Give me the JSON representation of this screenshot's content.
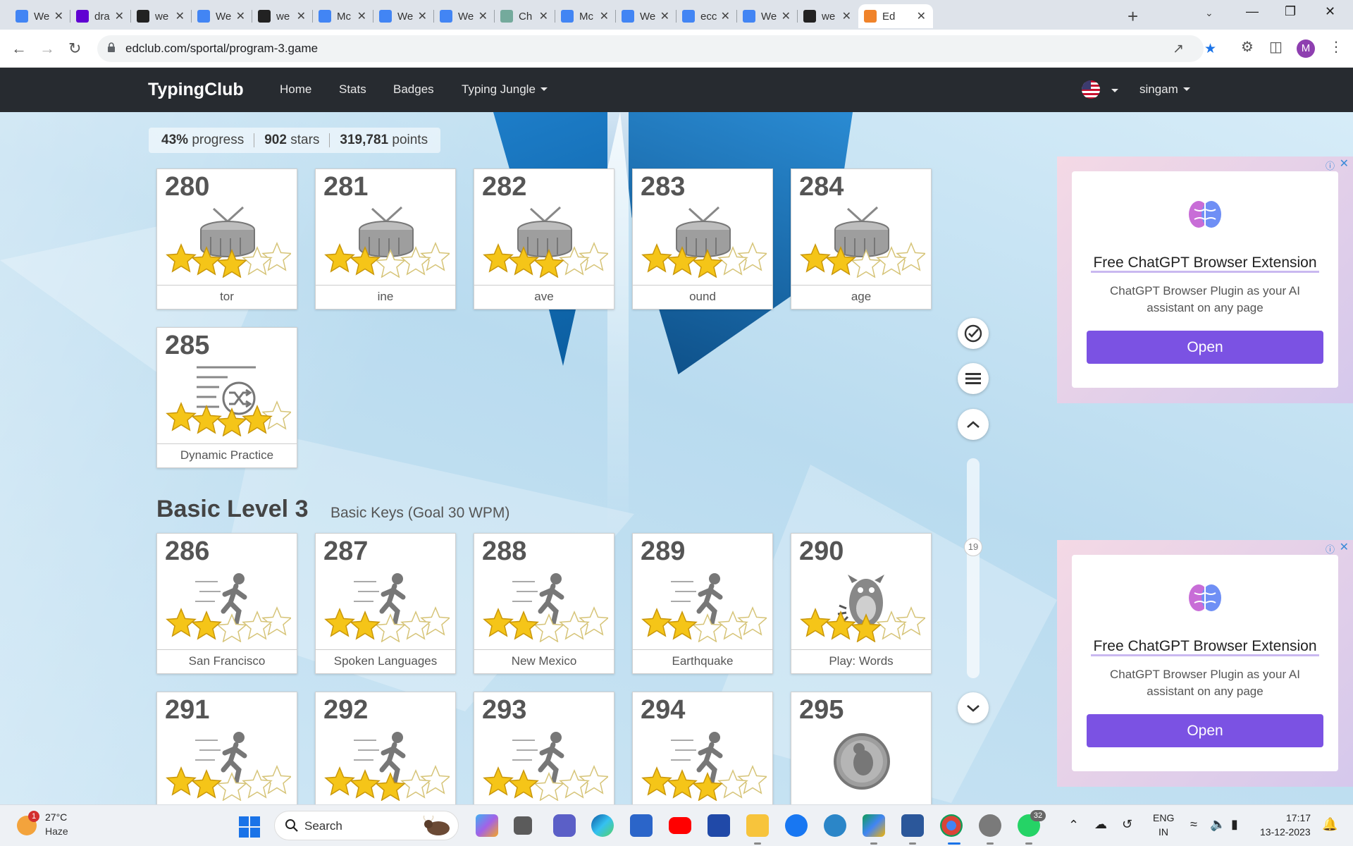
{
  "browser": {
    "tabs": [
      {
        "title": "We",
        "icon": "docs-icon",
        "color": "#4285f4"
      },
      {
        "title": "dra",
        "icon": "yahoo-icon",
        "color": "#6001d2"
      },
      {
        "title": "we",
        "icon": "notion-icon",
        "color": "#222222"
      },
      {
        "title": "We",
        "icon": "docs-icon",
        "color": "#4285f4"
      },
      {
        "title": "we",
        "icon": "notion-icon",
        "color": "#222222"
      },
      {
        "title": "Mc",
        "icon": "docs-icon",
        "color": "#4285f4"
      },
      {
        "title": "We",
        "icon": "docs-icon",
        "color": "#4285f4"
      },
      {
        "title": "We",
        "icon": "docs-icon",
        "color": "#4285f4"
      },
      {
        "title": "Ch",
        "icon": "chatgpt-icon",
        "color": "#74aa9c"
      },
      {
        "title": "Mc",
        "icon": "docs-icon",
        "color": "#4285f4"
      },
      {
        "title": "We",
        "icon": "docs-icon",
        "color": "#4285f4"
      },
      {
        "title": "ecc",
        "icon": "docs-icon",
        "color": "#4285f4"
      },
      {
        "title": "We",
        "icon": "docs-icon",
        "color": "#4285f4"
      },
      {
        "title": "we",
        "icon": "notion-icon",
        "color": "#222222"
      },
      {
        "title": "Ed",
        "icon": "edclub-icon",
        "color": "#f0832a",
        "active": true
      }
    ],
    "url": "edclub.com/sportal/program-3.game",
    "profile_initial": "M"
  },
  "site": {
    "brand": "TypingClub",
    "nav": [
      "Home",
      "Stats",
      "Badges",
      "Typing Jungle"
    ],
    "user": "singam"
  },
  "progress": {
    "percent": "43%",
    "percent_label": "progress",
    "stars": "902",
    "stars_label": "stars",
    "points": "319,781",
    "points_label": "points"
  },
  "lessons_top": [
    {
      "num": "280",
      "label": "tor",
      "stars": 3,
      "art": "drum-icon"
    },
    {
      "num": "281",
      "label": "ine",
      "stars": 2,
      "art": "drum-icon"
    },
    {
      "num": "282",
      "label": "ave",
      "stars": 3,
      "art": "drum-icon"
    },
    {
      "num": "283",
      "label": "ound",
      "stars": 3,
      "art": "drum-icon"
    },
    {
      "num": "284",
      "label": "age",
      "stars": 2,
      "art": "drum-icon"
    },
    {
      "num": "285",
      "label": "Dynamic Practice",
      "stars": 4,
      "art": "shuffle-icon"
    }
  ],
  "level": {
    "title": "Basic Level 3",
    "subtitle": "Basic Keys (Goal 30 WPM)"
  },
  "lessons_level3": [
    {
      "num": "286",
      "label": "San Francisco",
      "stars": 2,
      "art": "runner-icon"
    },
    {
      "num": "287",
      "label": "Spoken Languages",
      "stars": 2,
      "art": "runner-icon"
    },
    {
      "num": "288",
      "label": "New Mexico",
      "stars": 2,
      "art": "runner-icon"
    },
    {
      "num": "289",
      "label": "Earthquake",
      "stars": 2,
      "art": "runner-icon"
    },
    {
      "num": "290",
      "label": "Play: Words",
      "stars": 3,
      "art": "monster-icon"
    },
    {
      "num": "291",
      "label": "",
      "stars": 2,
      "art": "runner-icon"
    },
    {
      "num": "292",
      "label": "",
      "stars": 3,
      "art": "runner-icon"
    },
    {
      "num": "293",
      "label": "",
      "stars": 2,
      "art": "runner-icon"
    },
    {
      "num": "294",
      "label": "",
      "stars": 3,
      "art": "runner-icon"
    },
    {
      "num": "295",
      "label": "",
      "stars": 0,
      "art": "game-badge-icon"
    }
  ],
  "side_controls": {
    "scroll_number": "19"
  },
  "ads": [
    {
      "title": "Free ChatGPT Browser Extension",
      "desc": "ChatGPT Browser Plugin as your AI assistant on any page",
      "button": "Open"
    },
    {
      "title": "Free ChatGPT Browser Extension",
      "desc": "ChatGPT Browser Plugin as your AI assistant on any page",
      "button": "Open"
    }
  ],
  "taskbar": {
    "weather_temp": "27°C",
    "weather_cond": "Haze",
    "weather_badge": "1",
    "search": "Search",
    "lang_top": "ENG",
    "lang_bottom": "IN",
    "time": "17:17",
    "date": "13-12-2023",
    "whatsapp_badge": "32"
  },
  "colors": {
    "nav_bg": "#272b30",
    "star": "#f5c518",
    "ad_button": "#7b52e3"
  }
}
